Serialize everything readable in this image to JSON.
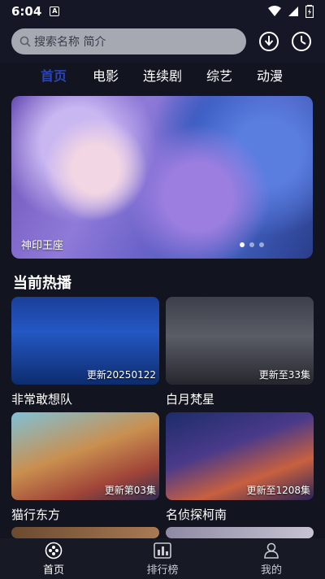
{
  "status": {
    "time": "6:04",
    "notif_glyph": "A"
  },
  "search": {
    "placeholder": "搜索名称 简介"
  },
  "tabs": [
    {
      "label": "首页",
      "active": true
    },
    {
      "label": "电影",
      "active": false
    },
    {
      "label": "连续剧",
      "active": false
    },
    {
      "label": "综艺",
      "active": false
    },
    {
      "label": "动漫",
      "active": false
    }
  ],
  "banner": {
    "caption": "神印王座"
  },
  "section": {
    "title": "当前热播"
  },
  "cards": [
    {
      "title": "非常敢想队",
      "badge": "更新20250122"
    },
    {
      "title": "白月梵星",
      "badge": "更新至33集"
    },
    {
      "title": "猫行东方",
      "badge": "更新第03集"
    },
    {
      "title": "名侦探柯南",
      "badge": "更新至1208集"
    }
  ],
  "nav": [
    {
      "label": "首页",
      "icon": "gamepad-icon"
    },
    {
      "label": "排行榜",
      "icon": "chart-icon"
    },
    {
      "label": "我的",
      "icon": "user-icon"
    }
  ],
  "colors": {
    "accent": "#2b45b8",
    "background": "#12141f"
  }
}
